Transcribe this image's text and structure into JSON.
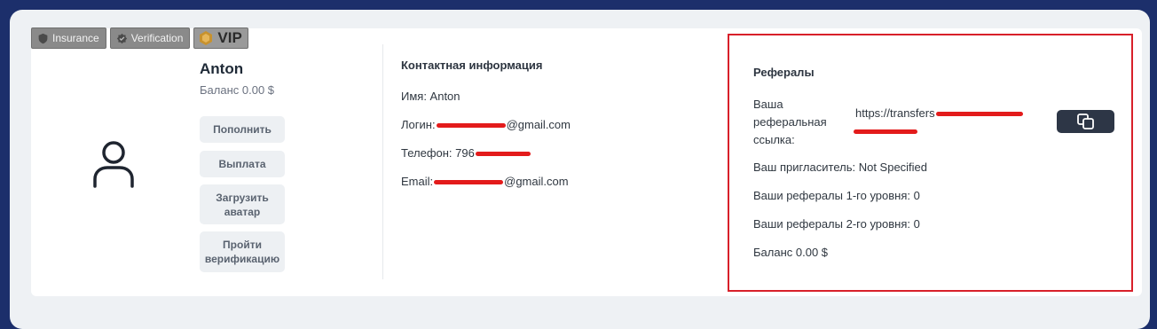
{
  "badges": [
    {
      "label": "Insurance",
      "icon": "shield-icon"
    },
    {
      "label": "Verification",
      "icon": "verified-badge-icon"
    },
    {
      "label": "VIP",
      "icon": "vip-diamond-icon"
    }
  ],
  "profile": {
    "name": "Anton",
    "balance": "Баланс 0.00 $",
    "avatar_icon": "user-icon",
    "buttons": {
      "topup": "Пополнить",
      "payout": "Выплата",
      "upload_avatar": "Загрузить аватар",
      "verify": "Пройти верификацию"
    }
  },
  "contact": {
    "title": "Контактная информация",
    "name_row": "Имя: Anton",
    "login_prefix": "Логин:",
    "login_suffix": "@gmail.com",
    "phone_prefix": "Телефон: 796",
    "email_prefix": "Email:",
    "email_suffix": "@gmail.com"
  },
  "referrals": {
    "title": "Рефералы",
    "link_label": "Ваша реферальная ссылка:",
    "link_visible": "https://transfers",
    "copy_icon": "copy-icon",
    "inviter": "Ваш пригласитель: Not Specified",
    "level1": "Ваши рефералы 1-го уровня: 0",
    "level2": "Ваши рефералы 2-го уровня: 0",
    "balance": "Баланс 0.00 $"
  },
  "colors": {
    "page_bg": "#1c2f6b",
    "highlight_border": "#d8202a",
    "redaction": "#e31b1b",
    "copy_button": "#2d3646"
  }
}
